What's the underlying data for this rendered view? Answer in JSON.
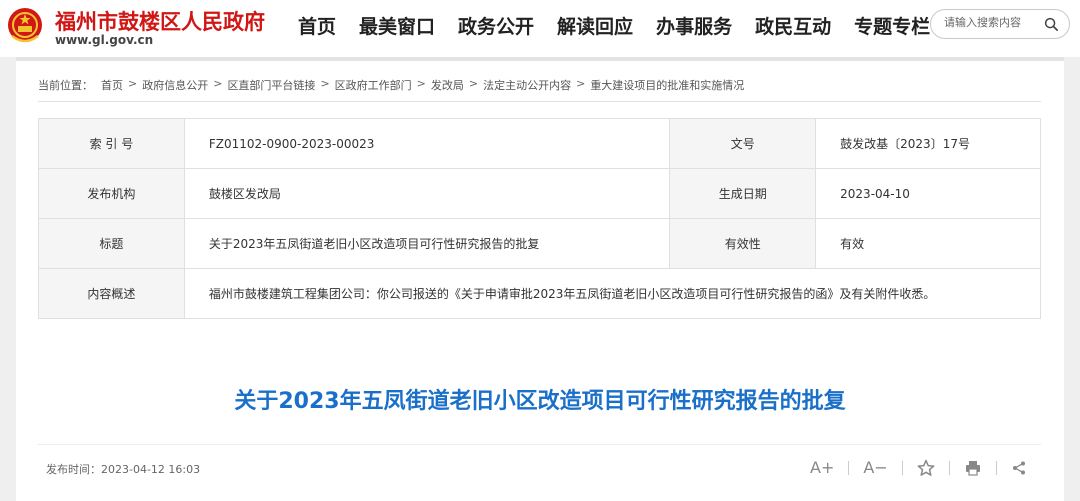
{
  "header": {
    "site_name": "福州市鼓楼区人民政府",
    "site_url": "www.gl.gov.cn",
    "nav": [
      "首页",
      "最美窗口",
      "政务公开",
      "解读回应",
      "办事服务",
      "政民互动",
      "专题专栏"
    ],
    "search_placeholder": "请输入搜索内容",
    "brand_color": "#d01715"
  },
  "breadcrumb": {
    "label": "当前位置：",
    "items": [
      "首页",
      "政府信息公开",
      "区直部门平台链接",
      "区政府工作部门",
      "发改局",
      "法定主动公开内容",
      "重大建设项目的批准和实施情况"
    ]
  },
  "info": {
    "index_label": "索 引 号",
    "index_value": "FZ01102-0900-2023-00023",
    "doc_no_label": "文号",
    "doc_no_value": "鼓发改基〔2023〕17号",
    "publisher_label": "发布机构",
    "publisher_value": "鼓楼区发改局",
    "date_label": "生成日期",
    "date_value": "2023-04-10",
    "title_label": "标题",
    "title_value": "关于2023年五凤街道老旧小区改造项目可行性研究报告的批复",
    "validity_label": "有效性",
    "validity_value": "有效",
    "summary_label": "内容概述",
    "summary_value": "福州市鼓楼建筑工程集团公司：你公司报送的《关于申请审批2023年五凤街道老旧小区改造项目可行性研究报告的函》及有关附件收悉。"
  },
  "article": {
    "title": "关于2023年五凤街道老旧小区改造项目可行性研究报告的批复",
    "title_color": "#1a6fc9",
    "publish_time": "发布时间：2023-04-12 16:03",
    "tools": {
      "font_up": "A+",
      "font_down": "A−"
    }
  }
}
